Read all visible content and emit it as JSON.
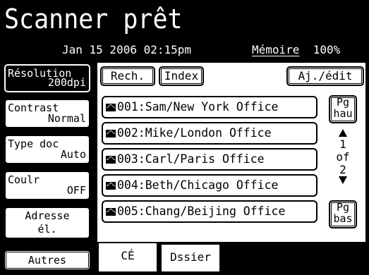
{
  "header": {
    "title": "Scanner prêt",
    "datetime": "Jan 15 2006 02:15pm",
    "memory_label": "Mémoire",
    "memory_value": "100%"
  },
  "left_buttons": [
    {
      "name": "resolution",
      "line1": "Résolution",
      "line2": "200dpi"
    },
    {
      "name": "contrast",
      "line1": "Contrast",
      "line2": "Normal"
    },
    {
      "name": "doc-type",
      "line1": "Type doc",
      "line2": "Auto"
    },
    {
      "name": "color",
      "line1": "Coulr",
      "line2": "OFF"
    },
    {
      "name": "email-address",
      "line1": "Adresse",
      "line2": "él."
    },
    {
      "name": "others",
      "line1": "Autres"
    }
  ],
  "toolbar": {
    "search_label": "Rech.",
    "index_label": "Index",
    "add_edit_label": "Aj./édit"
  },
  "entries": [
    {
      "label": "001:Sam/New York Office",
      "icon": "mail-icon"
    },
    {
      "label": "002:Mike/London Office",
      "icon": "mail-icon"
    },
    {
      "label": "003:Carl/Paris Office",
      "icon": "mail-icon"
    },
    {
      "label": "004:Beth/Chicago Office",
      "icon": "mail-icon"
    },
    {
      "label": "005:Chang/Beijing Office",
      "icon": "mail-icon"
    }
  ],
  "paging": {
    "page_up_line1": "Pg",
    "page_up_line2": "hau",
    "page_down_line1": "Pg",
    "page_down_line2": "bas",
    "current": "1",
    "of": "of",
    "total": "2"
  },
  "tabs": [
    {
      "label": "CÉ"
    },
    {
      "label": "Dssier"
    }
  ],
  "colors": {
    "background": "#000000",
    "surface": "#ffffff",
    "text": "#000000"
  }
}
